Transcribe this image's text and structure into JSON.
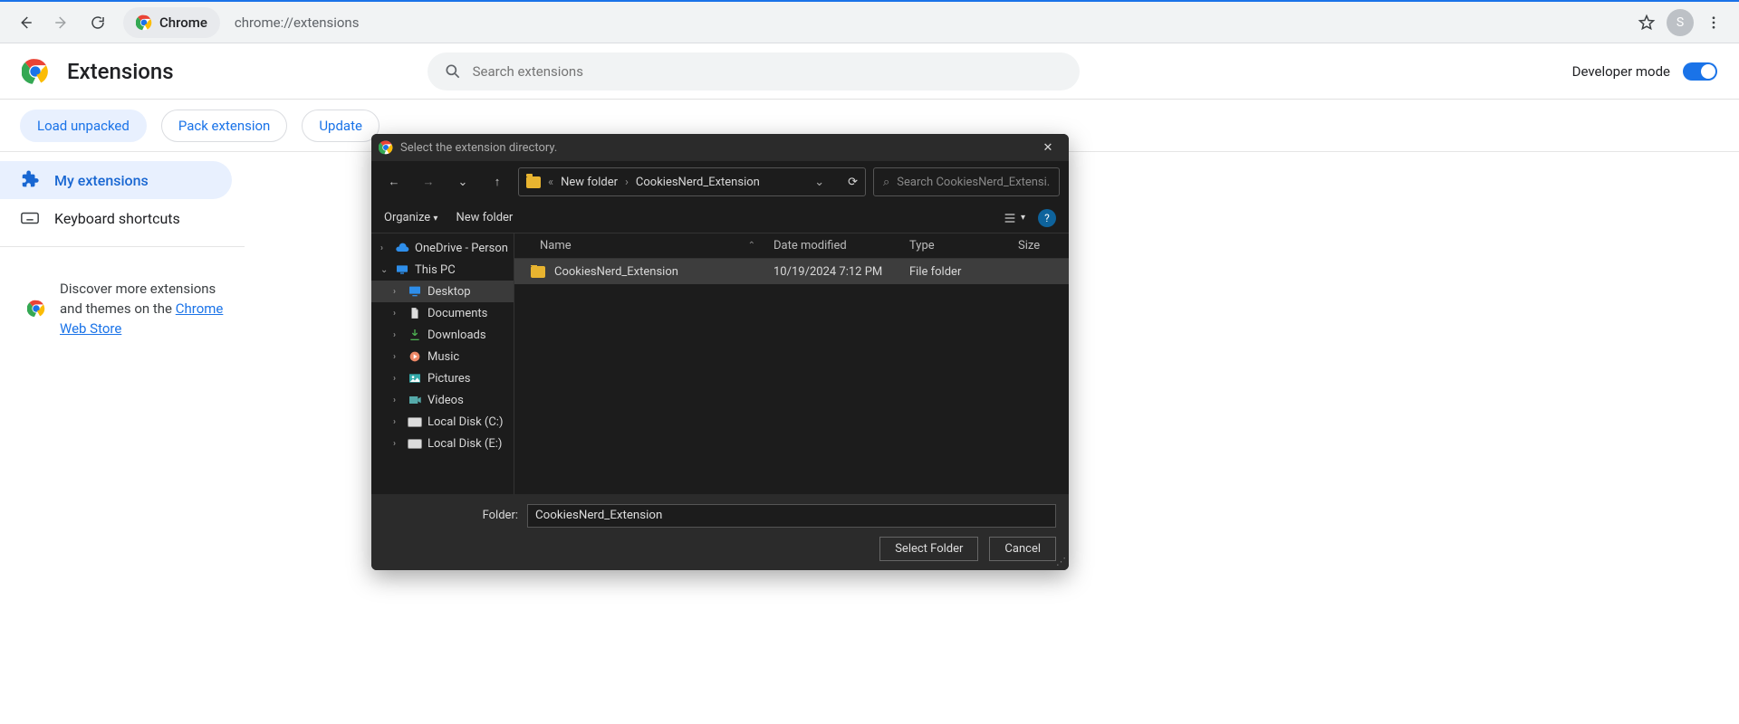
{
  "browser": {
    "name": "Chrome",
    "url": "chrome://extensions",
    "avatar_letter": "S"
  },
  "page": {
    "title": "Extensions",
    "search_placeholder": "Search extensions",
    "developer_mode_label": "Developer mode",
    "buttons": {
      "load_unpacked": "Load unpacked",
      "pack_extension": "Pack extension",
      "update": "Update"
    },
    "sidebar": {
      "my_extensions": "My extensions",
      "keyboard_shortcuts": "Keyboard shortcuts"
    },
    "discover_prefix": "Discover more extensions and themes on the ",
    "discover_link": "Chrome Web Store"
  },
  "dialog": {
    "title": "Select the extension directory.",
    "nav": {
      "crumb1": "New folder",
      "crumb2": "CookiesNerd_Extension",
      "search_placeholder": "Search CookiesNerd_Extensi..."
    },
    "toolbar": {
      "organize": "Organize",
      "new_folder": "New folder"
    },
    "tree": [
      {
        "label": "OneDrive - Person",
        "caret": "›",
        "icon": "cloud"
      },
      {
        "label": "This PC",
        "caret": "⌄",
        "icon": "pc"
      },
      {
        "label": "Desktop",
        "caret": "›",
        "icon": "desktop",
        "selected": true,
        "indent": 1
      },
      {
        "label": "Documents",
        "caret": "›",
        "icon": "doc",
        "indent": 1
      },
      {
        "label": "Downloads",
        "caret": "›",
        "icon": "down",
        "indent": 1
      },
      {
        "label": "Music",
        "caret": "›",
        "icon": "music",
        "indent": 1
      },
      {
        "label": "Pictures",
        "caret": "›",
        "icon": "pic",
        "indent": 1
      },
      {
        "label": "Videos",
        "caret": "›",
        "icon": "vid",
        "indent": 1
      },
      {
        "label": "Local Disk (C:)",
        "caret": "›",
        "icon": "drive",
        "indent": 1
      },
      {
        "label": "Local Disk (E:)",
        "caret": "›",
        "icon": "drive",
        "indent": 1
      }
    ],
    "columns": {
      "name": "Name",
      "date": "Date modified",
      "type": "Type",
      "size": "Size"
    },
    "rows": [
      {
        "name": "CookiesNerd_Extension",
        "date": "10/19/2024 7:12 PM",
        "type": "File folder",
        "size": ""
      }
    ],
    "footer": {
      "folder_label": "Folder:",
      "folder_value": "CookiesNerd_Extension",
      "select": "Select Folder",
      "cancel": "Cancel"
    }
  }
}
